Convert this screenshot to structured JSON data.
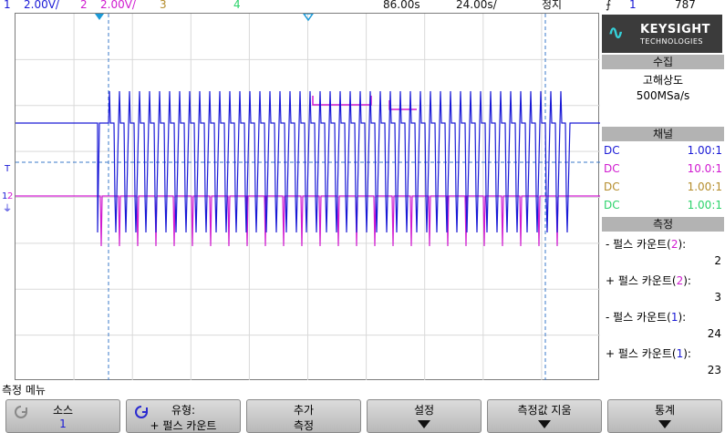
{
  "topbar": {
    "ch1_num": "1",
    "ch1_scale": "2.00V/",
    "ch2_num": "2",
    "ch2_scale": "2.00V/",
    "ch3_num": "3",
    "ch4_num": "4",
    "time_delay": "86.00s",
    "time_scale": "24.00s/",
    "run_state": "정지",
    "trigger_src": "1",
    "trigger_level": "787"
  },
  "colors": {
    "ch1": "#1a1ad6",
    "ch2": "#d01ad0",
    "ch3": "#b58d2c",
    "ch4": "#2bd36a",
    "grid": "#d9d9d9"
  },
  "brand": {
    "name": "KEYSIGHT",
    "sub": "TECHNOLOGIES"
  },
  "acquire": {
    "header": "수집",
    "mode": "고해상도",
    "rate": "500MSa/s"
  },
  "channels": {
    "header": "채널",
    "rows": [
      {
        "coupling": "DC",
        "ratio": "1.00:1"
      },
      {
        "coupling": "DC",
        "ratio": "10.0:1"
      },
      {
        "coupling": "DC",
        "ratio": "1.00:1"
      },
      {
        "coupling": "DC",
        "ratio": "1.00:1"
      }
    ]
  },
  "measure": {
    "header": "측정",
    "items": [
      {
        "prefix": "- 펄스 카운트(",
        "ch": "2",
        "suffix": "):",
        "value": "2"
      },
      {
        "prefix": "+ 펄스 카운트(",
        "ch": "2",
        "suffix": "):",
        "value": "3"
      },
      {
        "prefix": "- 펄스 카운트(",
        "ch": "1",
        "suffix": "):",
        "value": "24"
      },
      {
        "prefix": "+ 펄스 카운트(",
        "ch": "1",
        "suffix": "):",
        "value": "23"
      }
    ]
  },
  "menu": {
    "title": "측정 메뉴",
    "softkeys": [
      {
        "top": "소스",
        "bottom": "1"
      },
      {
        "top": "유형:",
        "bottom": "+ 펄스 카운트"
      },
      {
        "top": "추가",
        "bottom": "측정"
      },
      {
        "top": "설정",
        "bottom": ""
      },
      {
        "top": "측정값 지움",
        "bottom": ""
      },
      {
        "top": "통계",
        "bottom": ""
      }
    ]
  },
  "markers": {
    "trigger_t": "T",
    "ch1": "1",
    "ch2": "2"
  }
}
